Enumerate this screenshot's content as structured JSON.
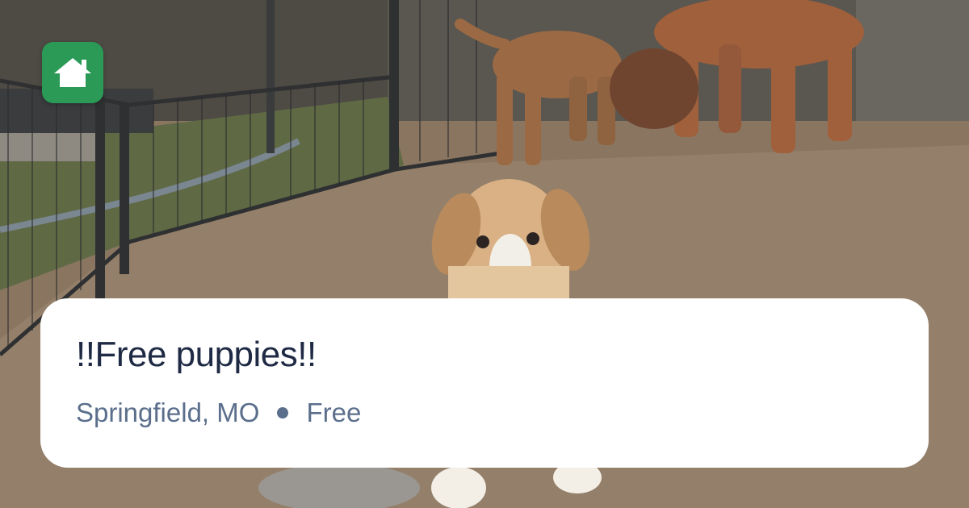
{
  "listing": {
    "title": "!!Free puppies!!",
    "location": "Springfield, MO",
    "price": "Free"
  },
  "brand": {
    "logo_icon": "house-icon",
    "accent_color": "#2a9a56"
  },
  "colors": {
    "title_text": "#1f2a44",
    "meta_text": "#5b6f8c",
    "card_background": "#ffffff"
  }
}
